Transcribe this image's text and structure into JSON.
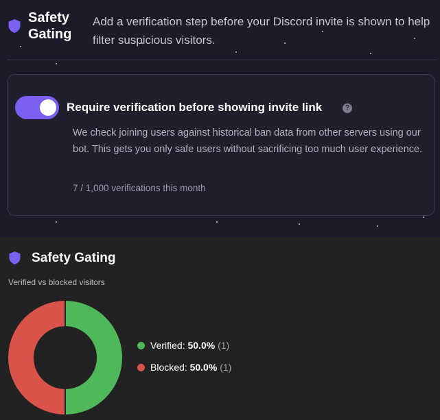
{
  "header": {
    "title": "Safety Gating",
    "description": "Add a verification step before your Discord invite is shown to help filter suspicious visitors.",
    "icon": "shield-icon",
    "accent_color": "#7b5ff0"
  },
  "card": {
    "toggle_on": true,
    "title": "Require verification before showing invite link",
    "help_icon": "?",
    "description": "We check joining users against historical ban data from other servers using our bot. This gets you only safe users without sacrificing too much user experience.",
    "count_text": "7 / 1,000 verifications this month"
  },
  "stats": {
    "title": "Safety Gating",
    "subtitle": "Verified vs blocked visitors",
    "icon": "shield-icon"
  },
  "chart_data": {
    "type": "pie",
    "title": "",
    "series": [
      {
        "name": "Verified",
        "value": 1,
        "percent": "50.0%",
        "count_label": "(1)",
        "color": "#4fb85a"
      },
      {
        "name": "Blocked",
        "value": 1,
        "percent": "50.0%",
        "count_label": "(1)",
        "color": "#d9534a"
      }
    ],
    "legend_placement": "right"
  }
}
